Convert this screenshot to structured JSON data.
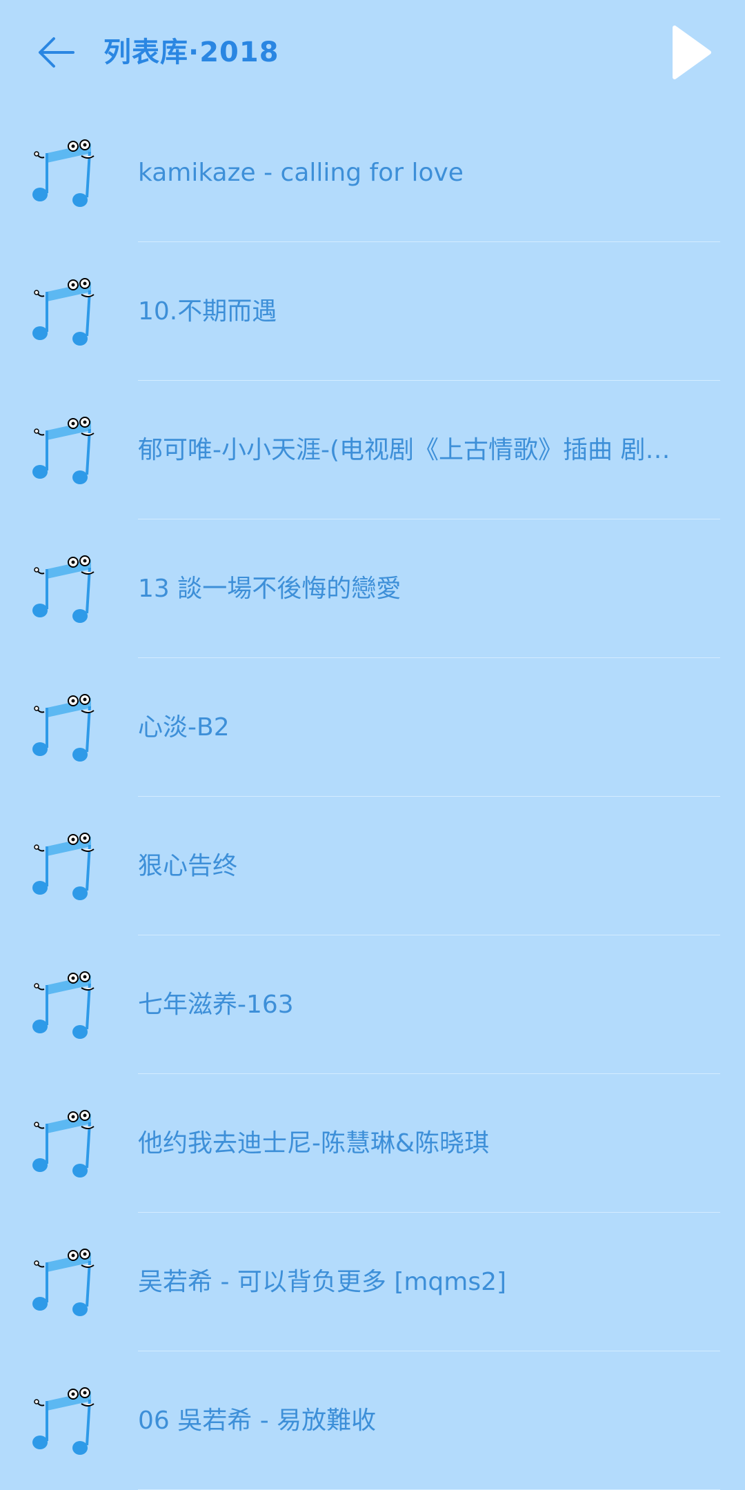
{
  "header": {
    "title": "列表库·2018",
    "back_icon": "arrow-left-icon",
    "play_icon": "play-icon"
  },
  "colors": {
    "background": "#b3dbfc",
    "accent": "#2a86e2",
    "text": "#3d8fd8",
    "divider": "#d4ecff"
  },
  "songs": [
    {
      "title": "kamikaze - calling for love"
    },
    {
      "title": "10.不期而遇"
    },
    {
      "title": "郁可唯-小小天涯-(电视剧《上古情歌》插曲 剧…"
    },
    {
      "title": "13 談一場不後悔的戀愛"
    },
    {
      "title": "心淡-B2"
    },
    {
      "title": "狠心告终"
    },
    {
      "title": "七年滋养-163"
    },
    {
      "title": "他约我去迪士尼-陈慧琳&陈晓琪"
    },
    {
      "title": "吴若希 - 可以背负更多 [mqms2]"
    },
    {
      "title": "06 吳若希 - 易放難收"
    }
  ]
}
